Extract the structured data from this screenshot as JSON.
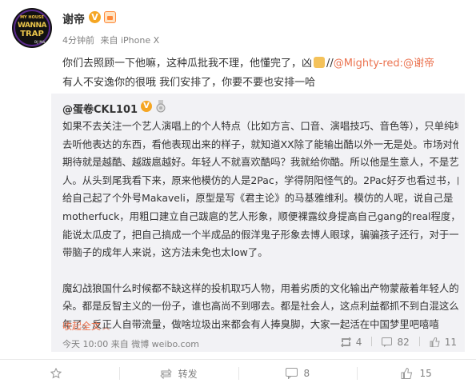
{
  "post": {
    "author": "谢帝",
    "meta": {
      "time": "4分钟前",
      "source": "来自 iPhone X"
    },
    "content": {
      "line1_text": "你们去照顾一下他嘛，这种瓜批我不理，他懂完了，凶",
      "line1_repost_marker": "//",
      "line1_mention": "@Mighty-red:@谢帝",
      "line2": "有人不安逸你的很哦 我们安排了，你要不要也安排一哈"
    },
    "avatar": {
      "line1": "MY HOUSE",
      "line2": "WANNA",
      "line3": "TRAP",
      "line4": "DJ MA"
    }
  },
  "repost": {
    "author": "@蛋卷CKL101",
    "lines": [
      "如果不去关注一个艺人演唱上的个人特点（比如方言、口音、演唱技巧、音色等），只单纯地",
      "去听他表达的东西，看他表现出来的样子，就知道XX除了能输出酷以外一无是处。市场对他的",
      "期待就是越酷、越跋扈越好。年轻人不就喜欢酷吗？我就给你酷。所以他是生意人，不是艺",
      "人。从头到尾我看下来，原来他模仿的人是2Pac，学得阴阳怪气的。2Pac好歹也看过书，自己",
      "给自己起了个外号Makaveli，原型是写《君主论》的马基雅维利。模仿的人呢，说自己是",
      "motherfuck，用粗口建立自己跋扈的艺人形象，顺便裸露纹身提高自己gang的real程度，我只",
      "能说太瓜皮了，把自己搞成一个半成品的假洋鬼子形象去博人眼球，骗骗孩子还行，对于一个",
      "带脑子的成年人来说，这方法未免也太low了。"
    ],
    "lines2": [
      "魔幻战狼国什么时候都不缺这样的投机取巧人物，用着劣质的文化输出产物蒙蔽着年轻人的耳",
      "朵。都是反智主义的一份子，谁也高尚不到哪去。都是社会人，这点利益都抓不到白混这么多",
      "年了。反正人自带流量，做啥垃圾出来都会有人捧臭脚，大家一起活在中国梦里吧嘻嘻"
    ],
    "collapse_label": "收起全文",
    "time": "今天 10:00 来自 微博 weibo.com",
    "stats": {
      "reposts": "4",
      "comments": "82",
      "likes": "11"
    }
  },
  "actions": {
    "favorite": "",
    "repost": "转发",
    "comment": "8",
    "like": "15"
  },
  "colors": {
    "accent": "#eb7350",
    "muted": "#808080",
    "quote_bg": "#f2f2f5"
  }
}
